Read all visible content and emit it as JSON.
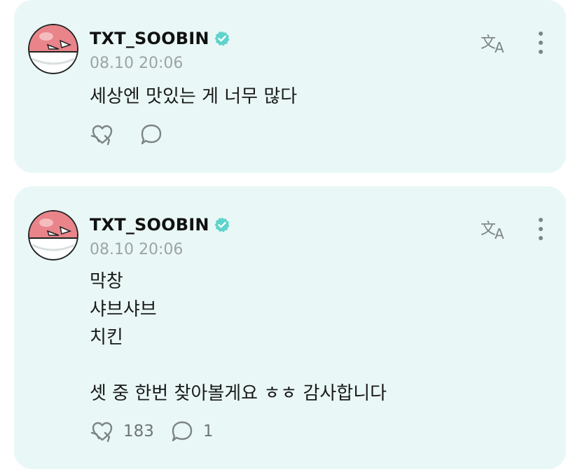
{
  "posts": [
    {
      "author": "TXT_SOOBIN",
      "time": "08.10 20:06",
      "text": "세상엔 맛있는 게 너무 많다",
      "likes": "",
      "comments": ""
    },
    {
      "author": "TXT_SOOBIN",
      "time": "08.10 20:06",
      "text": "막창\n샤브샤브\n치킨\n\n셋 중 한번 찾아볼게요 ㅎㅎ 감사합니다",
      "likes": "183",
      "comments": "1"
    }
  ],
  "colors": {
    "card_bg": "#e9f8f6",
    "verified": "#5fd3cc",
    "icon": "#7d8387",
    "muted_text": "#9ea3a6"
  },
  "icons": {
    "avatar": "voltorb-avatar",
    "verified": "verified-badge-icon",
    "translate": "translate-icon",
    "more": "more-vertical-icon",
    "like": "hug-heart-icon",
    "comment": "comment-bubble-icon"
  }
}
